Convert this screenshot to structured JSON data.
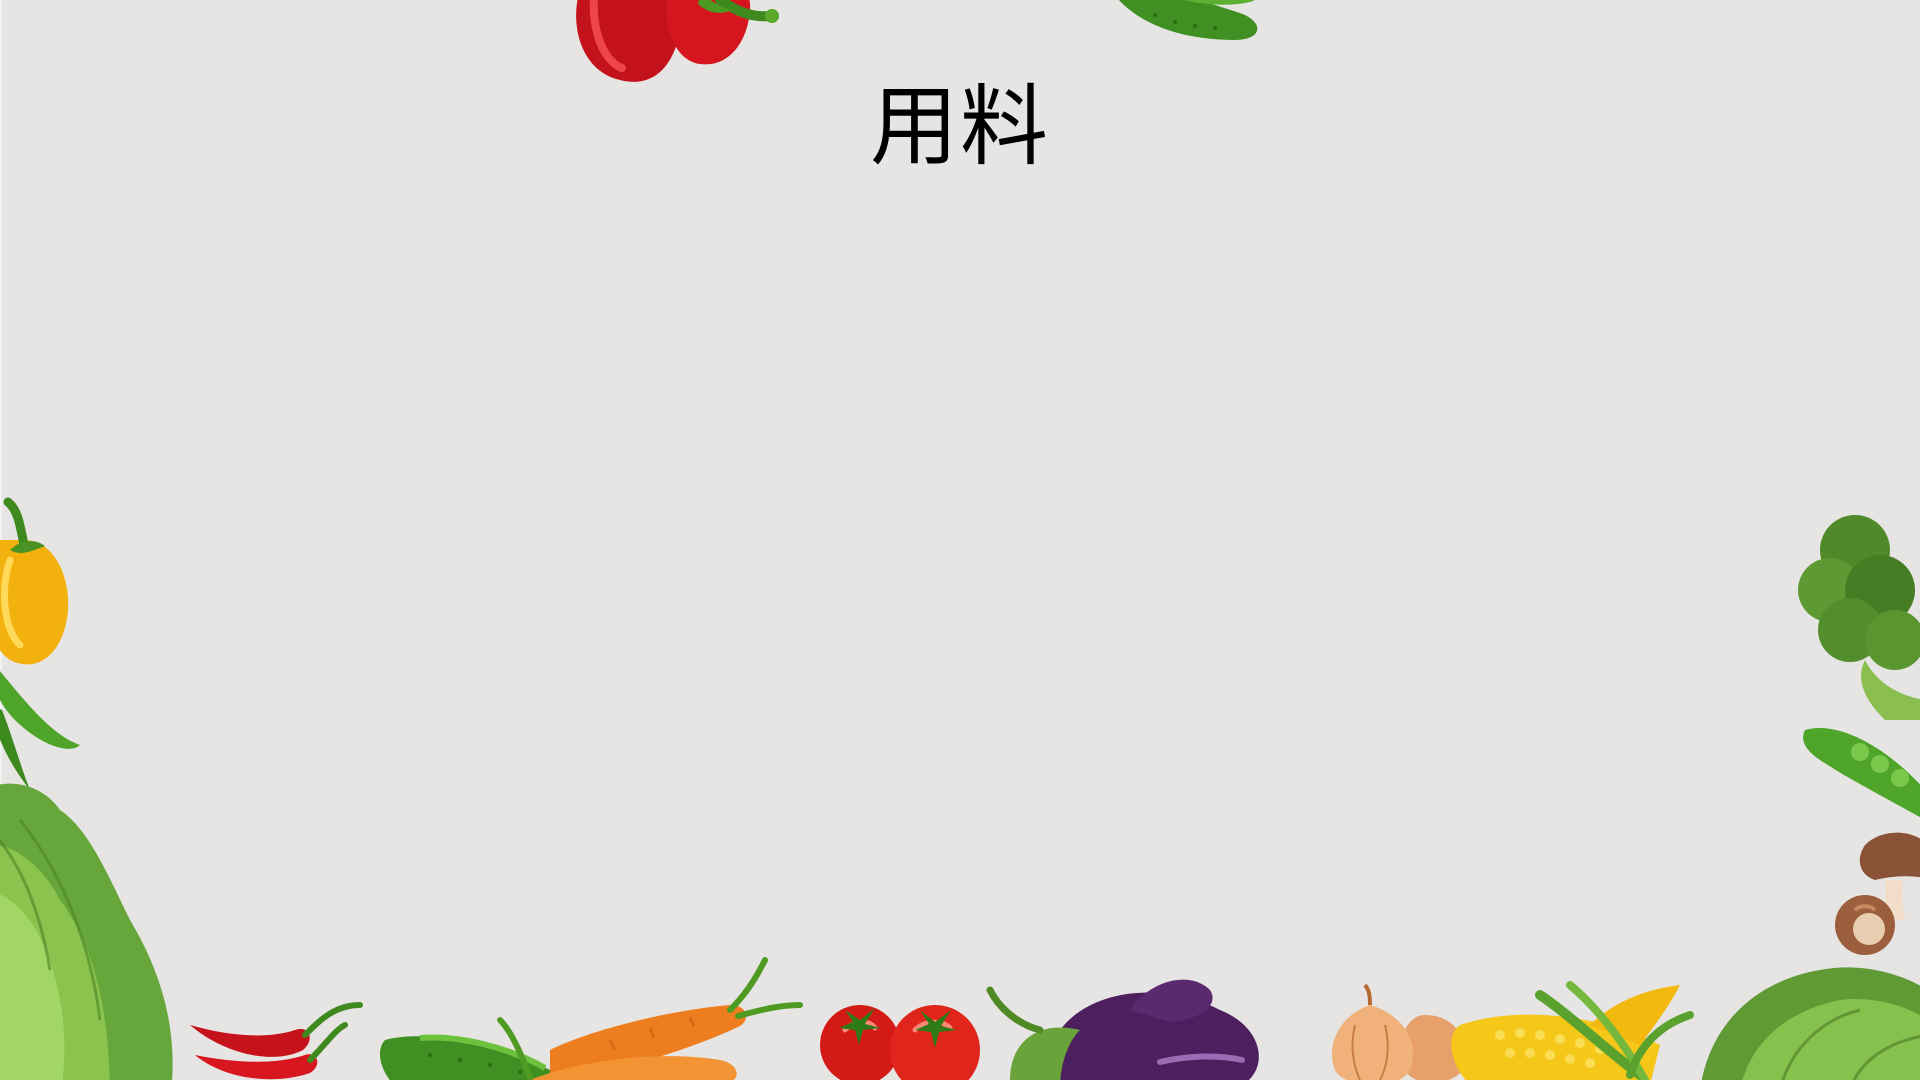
{
  "slide": {
    "title": "用料",
    "background_color": "#e6e5e3"
  },
  "decorations": [
    "red-bell-pepper-icon",
    "cucumber-icon",
    "yellow-bell-pepper-icon",
    "pea-pod-icon",
    "lettuce-icon",
    "chili-pepper-icon",
    "carrot-icon",
    "tomato-icon",
    "eggplant-icon",
    "onion-icon",
    "corn-icon",
    "broccoli-icon",
    "mushroom-icon"
  ]
}
